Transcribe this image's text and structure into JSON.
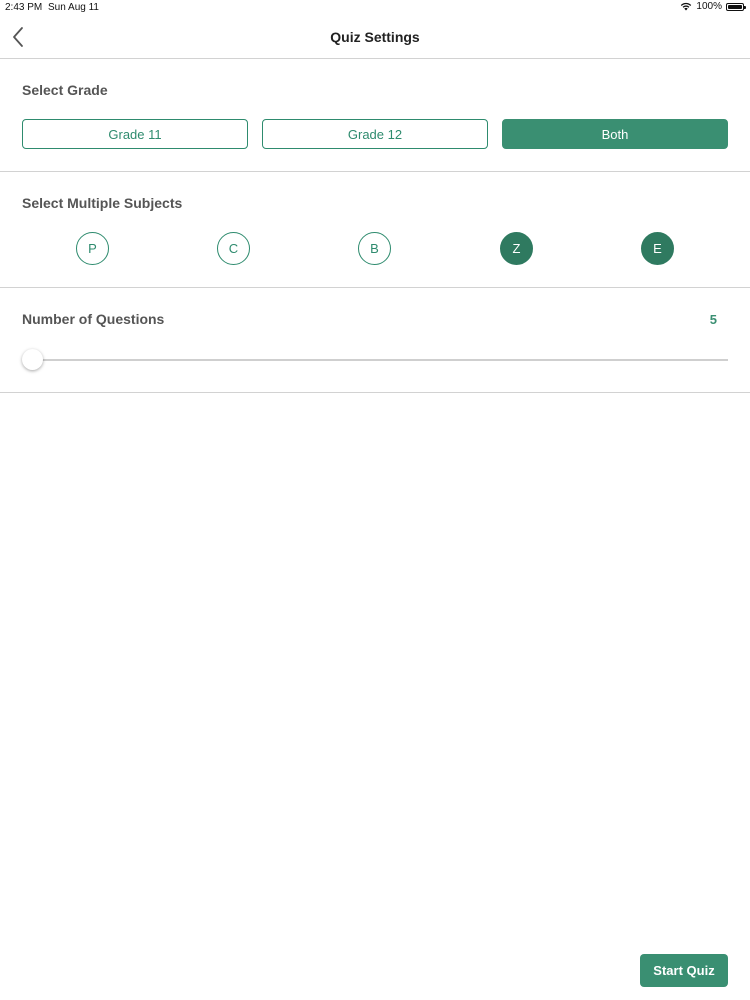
{
  "status_bar": {
    "time": "2:43 PM",
    "date": "Sun Aug 11",
    "battery_text": "100%",
    "battery_level": 1.0
  },
  "nav": {
    "title": "Quiz Settings",
    "back_icon": "chevron-left-icon"
  },
  "grade": {
    "title": "Select Grade",
    "options": [
      {
        "label": "Grade 11",
        "selected": false
      },
      {
        "label": "Grade 12",
        "selected": false
      },
      {
        "label": "Both",
        "selected": true
      }
    ]
  },
  "subjects": {
    "title": "Select Multiple Subjects",
    "options": [
      {
        "label": "P",
        "selected": false
      },
      {
        "label": "C",
        "selected": false
      },
      {
        "label": "B",
        "selected": false
      },
      {
        "label": "Z",
        "selected": true
      },
      {
        "label": "E",
        "selected": true
      }
    ]
  },
  "questions": {
    "title": "Number of Questions",
    "value": "5",
    "slider_fraction": 0.0
  },
  "start_button": {
    "label": "Start Quiz"
  },
  "colors": {
    "accent": "#3a8f72",
    "accent_dark": "#2f7a60",
    "divider": "#d2d2d2"
  }
}
